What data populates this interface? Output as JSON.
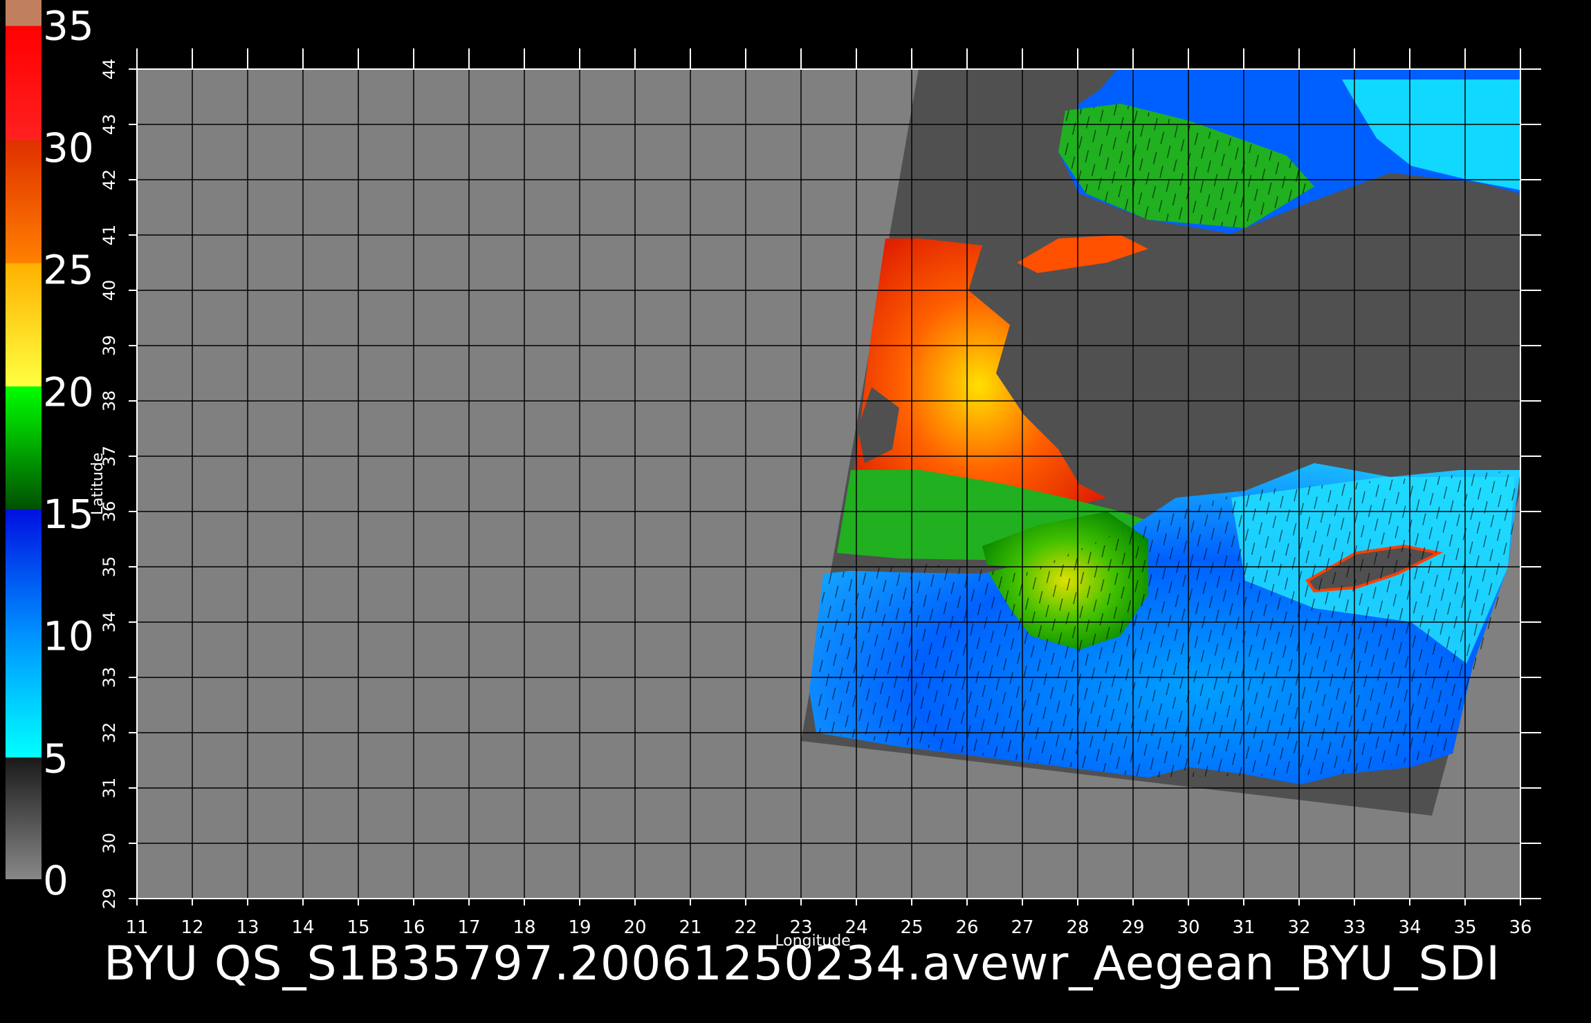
{
  "title": "BYU  QS_S1B35797.20061250234.avewr_Aegean_BYU_SDI",
  "x_axis": {
    "label": "Longitude",
    "ticks": [
      "11",
      "12",
      "13",
      "14",
      "15",
      "16",
      "17",
      "18",
      "19",
      "20",
      "21",
      "22",
      "23",
      "24",
      "25",
      "26",
      "27",
      "28",
      "29",
      "30",
      "31",
      "32",
      "33",
      "34",
      "35",
      "36"
    ]
  },
  "y_axis": {
    "label": "Latitude",
    "ticks": [
      "29",
      "30",
      "31",
      "32",
      "33",
      "34",
      "35",
      "36",
      "37",
      "38",
      "39",
      "40",
      "41",
      "42",
      "43",
      "44"
    ]
  },
  "colorbar": {
    "labels": [
      "0",
      "5",
      "10",
      "15",
      "20",
      "25",
      "30",
      "35"
    ],
    "segments": [
      {
        "from": 0,
        "to": 5,
        "colors": [
          "#808080",
          "#1a1a1a"
        ]
      },
      {
        "from": 5,
        "to": 10,
        "colors": [
          "#00ffff",
          "#0090ff"
        ]
      },
      {
        "from": 10,
        "to": 15,
        "colors": [
          "#0070ff",
          "#0010e0"
        ]
      },
      {
        "from": 15,
        "to": 20,
        "colors": [
          "#006000",
          "#00ff00"
        ]
      },
      {
        "from": 20,
        "to": 25,
        "colors": [
          "#ffff40",
          "#ffb000"
        ]
      },
      {
        "from": 25,
        "to": 30,
        "colors": [
          "#ff8000",
          "#e03000"
        ]
      },
      {
        "from": 30,
        "to": 35,
        "colors": [
          "#ff2020",
          "#ff0000"
        ]
      },
      {
        "from": 35,
        "to": 36,
        "colors": [
          "#c08060",
          "#c08060"
        ]
      }
    ]
  },
  "colors": {
    "background": "#000000",
    "no_data": "#808080",
    "land": "#505050",
    "grid": "#000000",
    "swath_edge": "#606060"
  }
}
